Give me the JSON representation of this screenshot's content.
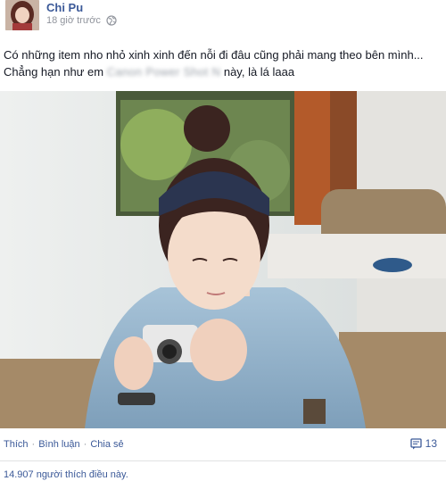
{
  "post": {
    "author": "Chi Pu",
    "time": "18 giờ trước",
    "line1": "Có những item nho nhỏ xinh xinh đến nỗi đi đâu cũng phải mang theo bên mình...",
    "line2_before": "Chẳng hạn như em",
    "line2_blurred": "Canon Power Shot N",
    "line2_after": "này, là lá laaa"
  },
  "actions": {
    "like": "Thích",
    "comment": "Bình luận",
    "share": "Chia sẻ",
    "separator": "·",
    "comment_count": "13"
  },
  "likes_text": "14.907 người thích điều này.",
  "colors": {
    "link": "#3b5998",
    "meta": "#90949c"
  },
  "icons": {
    "privacy": "globe-icon",
    "comments": "comment-icon"
  }
}
